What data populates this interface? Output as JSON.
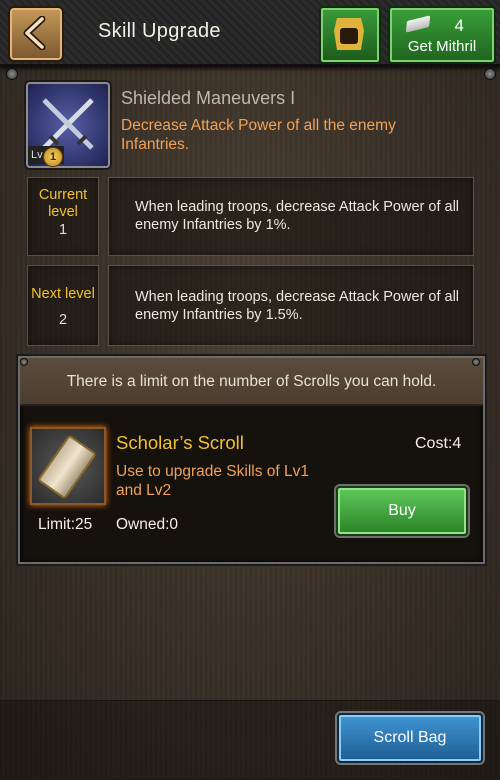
{
  "header": {
    "title": "Skill Upgrade",
    "back_icon": "chevron-left-icon",
    "shop_icon": "treasure-shop-icon",
    "mithril": {
      "count": "4",
      "label": "Get Mithril",
      "icon": "mithril-bar-icon"
    }
  },
  "skill": {
    "name": "Shielded Maneuvers I",
    "description": "Decrease Attack Power of all the enemy Infantries.",
    "lv_prefix": "Lv",
    "lv_value": "1",
    "icon": "crossed-swords-icon"
  },
  "current_level": {
    "label": "Current level",
    "value": "1",
    "text": "When leading troops, decrease Attack Power of all enemy Infantries by 1%."
  },
  "next_level": {
    "label": "Next level",
    "value": "2",
    "text": "When leading troops, decrease Attack Power of all enemy Infantries by 1.5%."
  },
  "scroll_shop": {
    "notice": "There is a limit on the number of Scrolls you can hold.",
    "item": {
      "name": "Scholar’s Scroll",
      "description": "Use to upgrade Skills of Lv1 and  Lv2",
      "cost": "Cost:4",
      "limit": "Limit:25",
      "owned": "Owned:0",
      "icon": "scroll-icon"
    },
    "buy_label": "Buy"
  },
  "footer": {
    "scroll_bag_label": "Scroll Bag"
  },
  "colors": {
    "accent_orange": "#f0a25a",
    "accent_gold": "#f2c12e",
    "button_green": "#3aa03a",
    "button_blue": "#3f95d3"
  }
}
